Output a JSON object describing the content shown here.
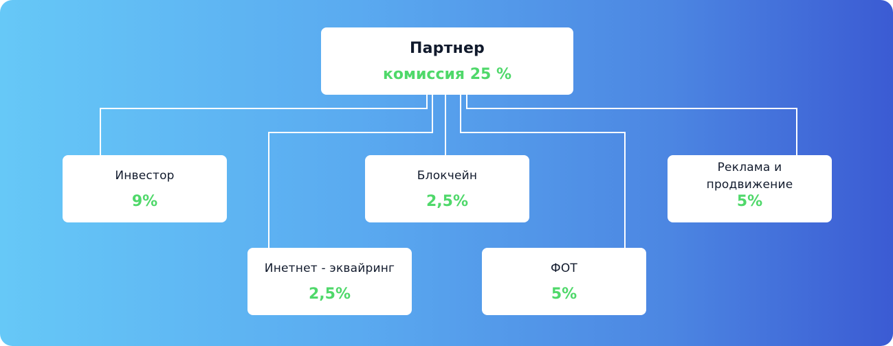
{
  "root": {
    "title": "Партнер",
    "subtitle": "комиссия 25 %"
  },
  "nodes": [
    {
      "label": "Инвестор",
      "value": "9%"
    },
    {
      "label": "Блокчейн",
      "value": "2,5%"
    },
    {
      "label_line1": "Реклама и",
      "label_line2": "продвижение",
      "value": "5%"
    },
    {
      "label": "Инетнет - эквайринг",
      "value": "2,5%"
    },
    {
      "label": "ФОТ",
      "value": "5%"
    }
  ],
  "colors": {
    "accent_green": "#4fd86a",
    "text_dark": "#111a2c",
    "gradient_start": "#66c8f7",
    "gradient_end": "#3b5bd3",
    "connector": "#ffffff"
  }
}
